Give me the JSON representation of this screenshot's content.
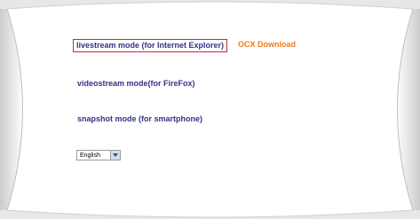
{
  "links": {
    "livestream": "livestream mode (for Internet Explorer)",
    "ocx_download": "OCX Download",
    "videostream": "videostream mode(for FireFox)",
    "snapshot": "snapshot mode (for smartphone)"
  },
  "language_select": {
    "value": "English"
  },
  "colors": {
    "link": "#33338a",
    "ocx": "#f07b1d",
    "highlight_border": "#d8232a",
    "panel": "#ffffff",
    "background": "#e7e7e7"
  }
}
